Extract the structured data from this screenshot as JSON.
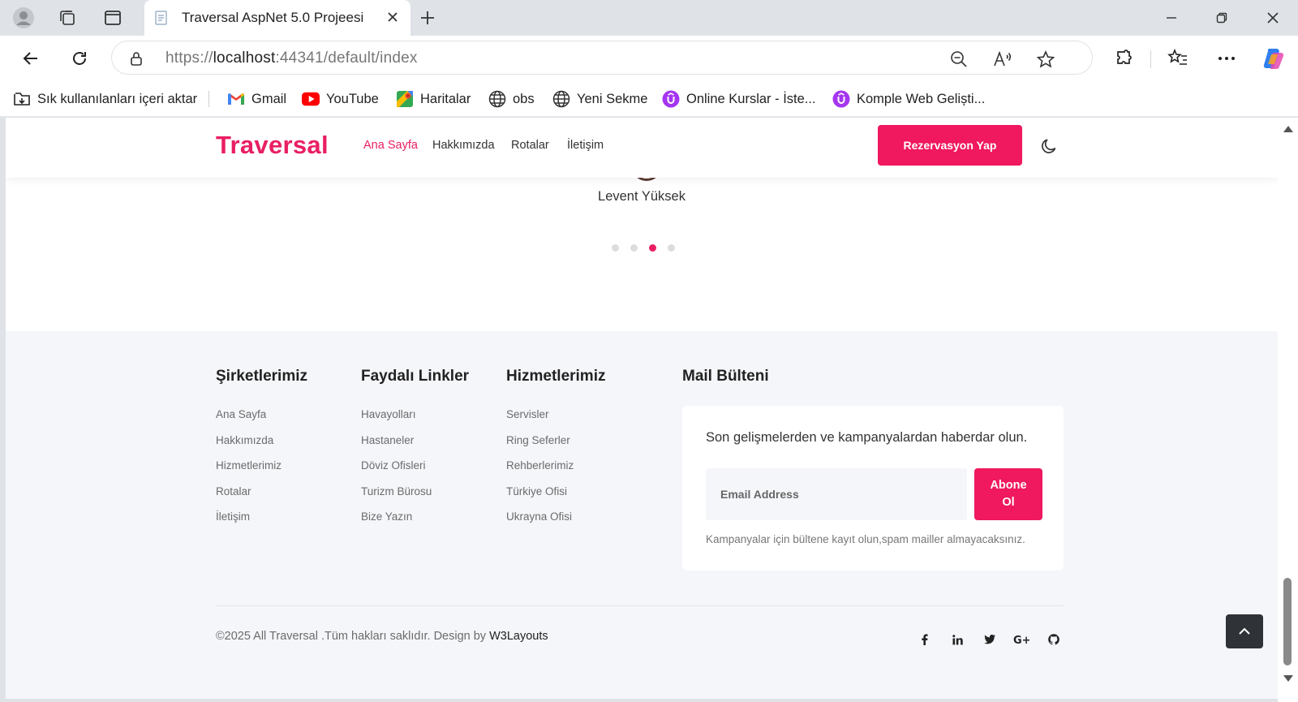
{
  "browser": {
    "tab_title": "Traversal AspNet 5.0 Projeesi",
    "url_prefix": "https://",
    "url_host": "localhost",
    "url_rest": ":44341/default/index",
    "bookmarks": {
      "import": "Sık kullanılanları içeri aktar",
      "gmail": "Gmail",
      "youtube": "YouTube",
      "maps": "Haritalar",
      "obs": "obs",
      "new_tab": "Yeni Sekme",
      "online_courses": "Online Kurslar - İste...",
      "web_dev": "Komple Web Geliști..."
    }
  },
  "site": {
    "logo": "Traversal",
    "nav": {
      "home": "Ana Sayfa",
      "about": "Hakkımızda",
      "routes": "Rotalar",
      "contact": "İletişim"
    },
    "cta": "Rezervasyon Yap",
    "accent_color": "#e91e63"
  },
  "testimonial": {
    "name": "Levent Yüksek",
    "slides": 4,
    "active_slide": 3
  },
  "footer": {
    "companies": {
      "title": "Şirketlerimiz",
      "links": [
        "Ana Sayfa",
        "Hakkımızda",
        "Hizmetlerimiz",
        "Rotalar",
        "İletişim"
      ]
    },
    "useful": {
      "title": "Faydalı Linkler",
      "links": [
        "Havayolları",
        "Hastaneler",
        "Döviz Ofisleri",
        "Turizm Bürosu",
        "Bize Yazın"
      ]
    },
    "services": {
      "title": "Hizmetlerimiz",
      "links": [
        "Servisler",
        "Ring Seferler",
        "Rehberlerimiz",
        "Türkiye Ofisi",
        "Ukrayna Ofisi"
      ]
    },
    "newsletter": {
      "title": "Mail Bülteni",
      "text": "Son gelişmelerden ve kampanyalardan haberdar olun.",
      "placeholder": "Email Address",
      "button": "Abone Ol",
      "note": "Kampanyalar için bültene kayıt olun,spam mailler almayacaksınız."
    },
    "copyright": "©2025 All Traversal .Tüm hakları saklıdır. Design by ",
    "designer": "W3Layouts",
    "social": [
      "facebook",
      "linkedin",
      "twitter",
      "google-plus",
      "github"
    ]
  }
}
